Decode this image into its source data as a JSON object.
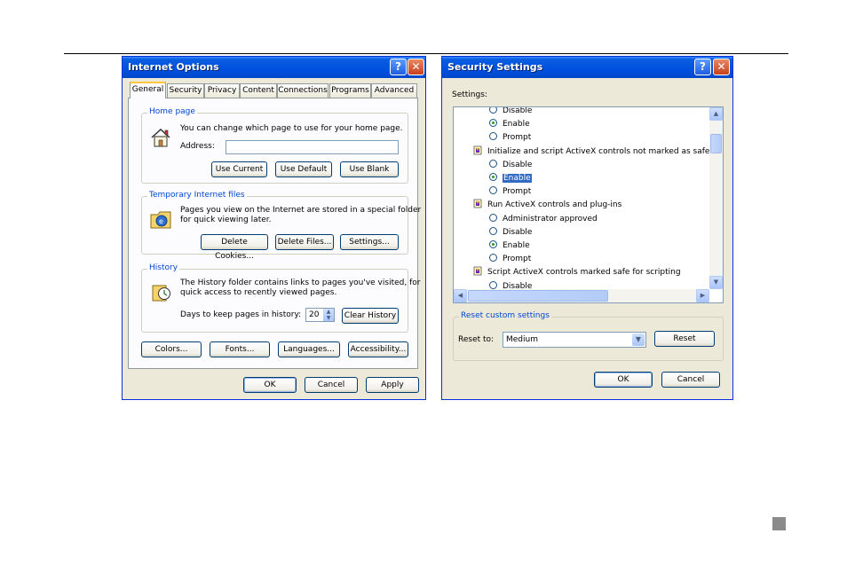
{
  "internet_options": {
    "title": "Internet Options",
    "tabs": [
      "General",
      "Security",
      "Privacy",
      "Content",
      "Connections",
      "Programs",
      "Advanced"
    ],
    "home_page": {
      "legend": "Home page",
      "description": "You can change which page to use for your home page.",
      "address_label": "Address:",
      "address_value": "",
      "buttons": [
        "Use Current",
        "Use Default",
        "Use Blank"
      ]
    },
    "temp_files": {
      "legend": "Temporary Internet files",
      "description_line1": "Pages you view on the Internet are stored in a special folder",
      "description_line2": "for quick viewing later.",
      "buttons": [
        "Delete Cookies...",
        "Delete Files...",
        "Settings..."
      ]
    },
    "history": {
      "legend": "History",
      "description_line1": "The History folder contains links to pages you've visited, for",
      "description_line2": "quick access to recently viewed pages.",
      "days_label": "Days to keep pages in history:",
      "days_value": "20",
      "clear_button": "Clear History"
    },
    "bottom_buttons": [
      "Colors...",
      "Fonts...",
      "Languages...",
      "Accessibility..."
    ],
    "dialog_buttons": {
      "ok": "OK",
      "cancel": "Cancel",
      "apply": "Apply"
    }
  },
  "security_settings": {
    "title": "Security Settings",
    "settings_label": "Settings:",
    "items": [
      {
        "type": "radio",
        "label": "Disable",
        "checked": false
      },
      {
        "type": "radio",
        "label": "Enable",
        "checked": true
      },
      {
        "type": "radio",
        "label": "Prompt",
        "checked": false
      },
      {
        "type": "category",
        "label": "Initialize and script ActiveX controls not marked as safe"
      },
      {
        "type": "radio",
        "label": "Disable",
        "checked": false
      },
      {
        "type": "radio",
        "label": "Enable",
        "checked": true,
        "selected": true
      },
      {
        "type": "radio",
        "label": "Prompt",
        "checked": false
      },
      {
        "type": "category",
        "label": "Run ActiveX controls and plug-ins"
      },
      {
        "type": "radio",
        "label": "Administrator approved",
        "checked": false
      },
      {
        "type": "radio",
        "label": "Disable",
        "checked": false
      },
      {
        "type": "radio",
        "label": "Enable",
        "checked": true
      },
      {
        "type": "radio",
        "label": "Prompt",
        "checked": false
      },
      {
        "type": "category",
        "label": "Script ActiveX controls marked safe for scripting"
      },
      {
        "type": "radio",
        "label": "Disable",
        "checked": false
      }
    ],
    "reset_group": {
      "legend": "Reset custom settings",
      "reset_to_label": "Reset to:",
      "reset_to_value": "Medium",
      "reset_button": "Reset"
    },
    "dialog_buttons": {
      "ok": "OK",
      "cancel": "Cancel"
    }
  },
  "colors": {
    "accent": "#0046d5",
    "selection": "#316ac5",
    "title_bar": "#0050e0"
  }
}
